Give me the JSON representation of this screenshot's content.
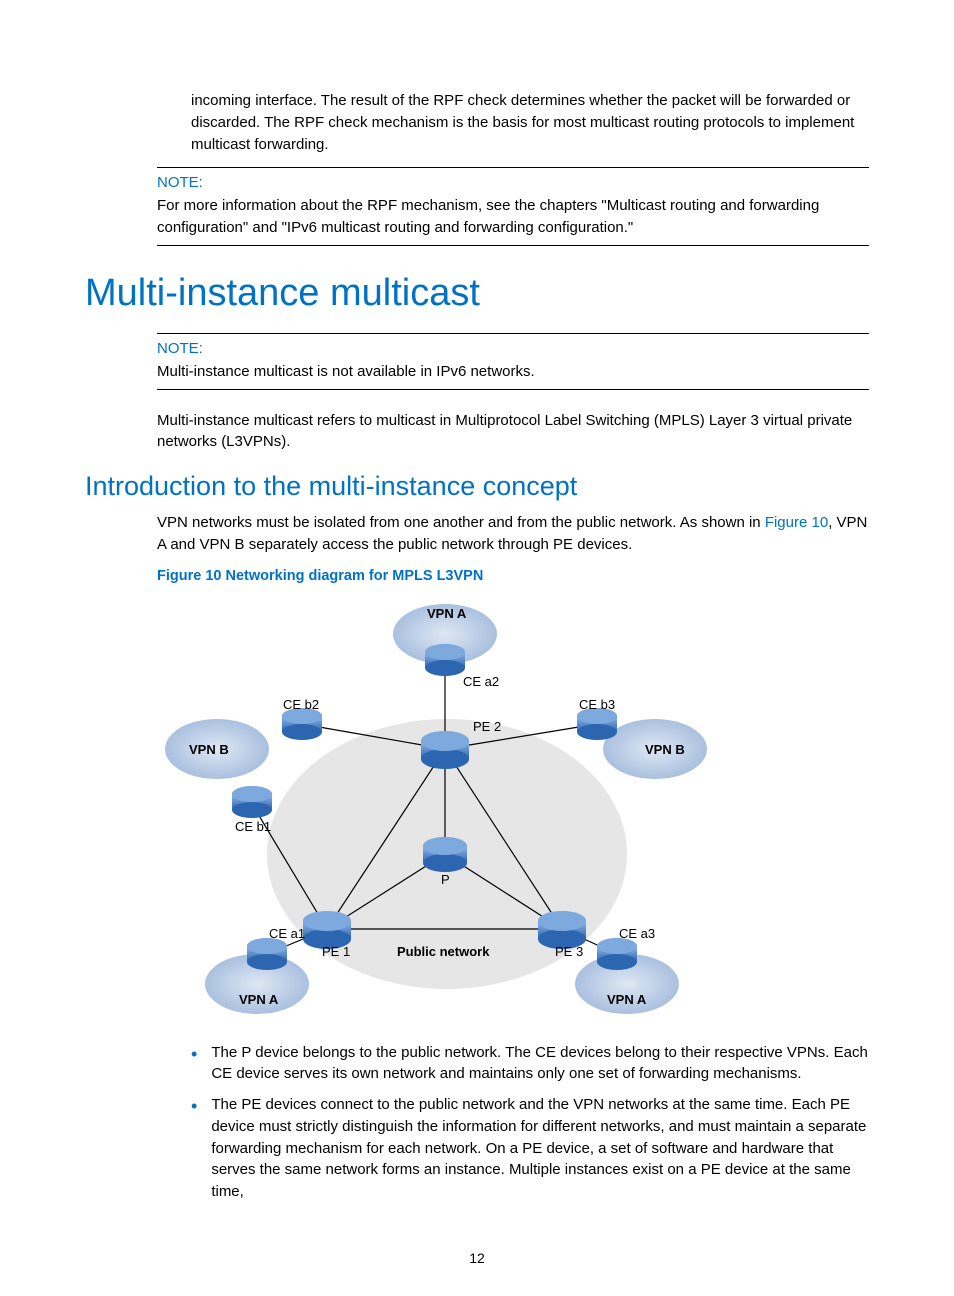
{
  "intro_para": "incoming interface. The result of the RPF check determines whether the packet will be forwarded or discarded. The RPF check mechanism is the basis for most multicast routing protocols to implement multicast forwarding.",
  "note1": {
    "label": "NOTE:",
    "text": "For more information about the RPF mechanism, see the chapters \"Multicast routing and forwarding configuration\" and \"IPv6 multicast routing and forwarding configuration.\""
  },
  "h1": "Multi-instance multicast",
  "note2": {
    "label": "NOTE:",
    "text": "Multi-instance multicast is not available in IPv6 networks."
  },
  "para2": "Multi-instance multicast refers to multicast in Multiprotocol Label Switching (MPLS) Layer 3 virtual private networks (L3VPNs).",
  "h2": "Introduction to the multi-instance concept",
  "para3a": "VPN networks must be isolated from one another and from the public network. As shown in ",
  "para3link": "Figure 10",
  "para3b": ", VPN A and VPN B separately access the public network through PE devices.",
  "figcap": "Figure 10 Networking diagram for MPLS L3VPN",
  "diagram": {
    "vpn_a_top": "VPN A",
    "vpn_b_left": "VPN B",
    "vpn_b_right": "VPN B",
    "vpn_a_bl": "VPN A",
    "vpn_a_br": "VPN A",
    "ce_a2": "CE a2",
    "ce_b2": "CE b2",
    "ce_b3": "CE b3",
    "ce_b1": "CE b1",
    "ce_a1": "CE a1",
    "ce_a3": "CE a3",
    "pe1": "PE 1",
    "pe2": "PE 2",
    "pe3": "PE 3",
    "p": "P",
    "pubnet": "Public network"
  },
  "bullets": [
    "The P device belongs to the public network. The CE devices belong to their respective VPNs. Each CE device serves its own network and maintains only one set of forwarding mechanisms.",
    "The PE devices connect to the public network and the VPN networks at the same time. Each PE device must strictly distinguish the information for different networks, and must maintain a separate forwarding mechanism for each network. On a PE device, a set of software and hardware that serves the same network forms an instance. Multiple instances exist on a PE device at the same time,"
  ],
  "page": "12"
}
